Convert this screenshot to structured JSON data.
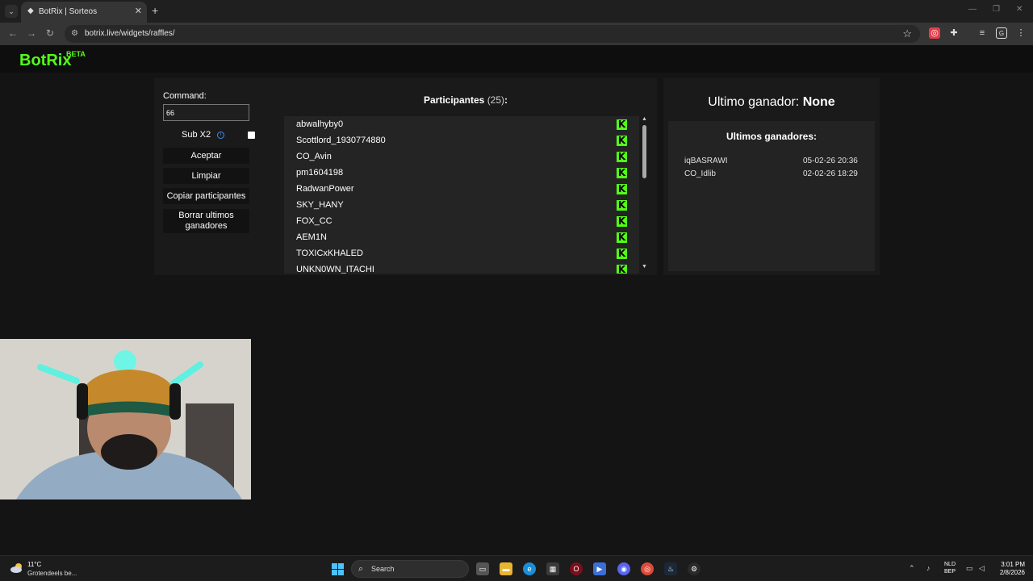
{
  "browser": {
    "tab_title": "BotRix | Sorteos",
    "url": "botrix.live/widgets/raffles/"
  },
  "site": {
    "logo": "BotRix",
    "beta": "BETA"
  },
  "controls": {
    "command_label": "Command:",
    "command_value": "66",
    "sub_label": "Sub X2",
    "sub_checked": false,
    "accept_button": "Aceptar",
    "clear_button": "Limpiar",
    "copy_button": "Copiar participantes",
    "delete_button": "Borrar ultimos ganadores"
  },
  "participants": {
    "title": "Participantes",
    "count": "(25)",
    "colon": ":",
    "list": [
      "abwalhyby0",
      "Scottlord_1930774880",
      "CO_Avin",
      "pm1604198",
      "RadwanPower",
      "SKY_HANY",
      "FOX_CC",
      "AEM1N",
      "TOXICxKHALED",
      "UNKN0WN_ITACHI"
    ],
    "badge_glyph": "K",
    "badge_color": "#53fc18"
  },
  "winner": {
    "label": "Ultimo ganador:",
    "value": "None",
    "recent_title": "Ultimos ganadores:",
    "recent": [
      {
        "name": "iqBASRAWI",
        "date": "05-02-26 20:36"
      },
      {
        "name": "CO_Idlib",
        "date": "02-02-26 18:29"
      }
    ]
  },
  "taskbar": {
    "weather_temp": "11°C",
    "weather_desc": "Grotendeels be...",
    "search_placeholder": "Search",
    "lang_top": "NLD",
    "lang_bottom": "BEP",
    "time": "3:01 PM",
    "date": "2/8/2026"
  },
  "colors": {
    "accent": "#53fc18",
    "info": "#3b8ff2"
  }
}
